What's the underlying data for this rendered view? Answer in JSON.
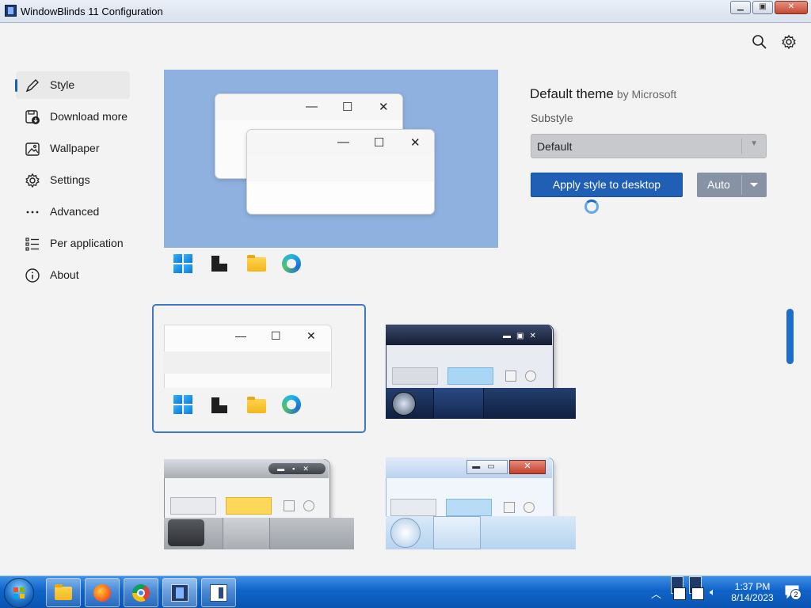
{
  "window": {
    "title": "WindowBlinds 11 Configuration",
    "controls": {
      "minimize": "▁",
      "maximize": "▣",
      "close": "✕"
    }
  },
  "topbar": {
    "search_icon": "search-icon",
    "settings_icon": "gear-icon"
  },
  "nav": {
    "items": [
      {
        "label": "Style",
        "icon": "brush-icon",
        "selected": true
      },
      {
        "label": "Download more s",
        "icon": "download-icon",
        "selected": false
      },
      {
        "label": "Wallpaper",
        "icon": "image-icon",
        "selected": false
      },
      {
        "label": "Settings",
        "icon": "gear-icon",
        "selected": false
      },
      {
        "label": "Advanced",
        "icon": "more-icon",
        "selected": false
      },
      {
        "label": "Per application",
        "icon": "list-icon",
        "selected": false
      },
      {
        "label": "About",
        "icon": "info-icon",
        "selected": false
      }
    ]
  },
  "details": {
    "theme_name": "Default theme",
    "author": "by Microsoft",
    "substyle_label": "Substyle",
    "substyle_value": "Default",
    "apply_label": "Apply style to desktop",
    "auto_label": "Auto"
  },
  "preview": {
    "window_controls": {
      "minimize": "—",
      "maximize": "☐",
      "close": "✕"
    }
  },
  "themes": [
    {
      "name": "windows-11-default",
      "selected": true
    },
    {
      "name": "dark-blue-glass",
      "selected": false
    },
    {
      "name": "silver-aero",
      "selected": false
    },
    {
      "name": "light-blue-classic",
      "selected": false
    }
  ],
  "taskbar": {
    "apps": [
      "file-explorer-icon",
      "firefox-icon",
      "chrome-icon",
      "windowblinds-icon",
      "settings-app-icon"
    ],
    "clock_time": "1:37 PM",
    "clock_date": "8/14/2023",
    "notification_count": "2",
    "colors": {
      "taskbar": "#0f63c8",
      "accent": "#1f5fb6"
    }
  }
}
